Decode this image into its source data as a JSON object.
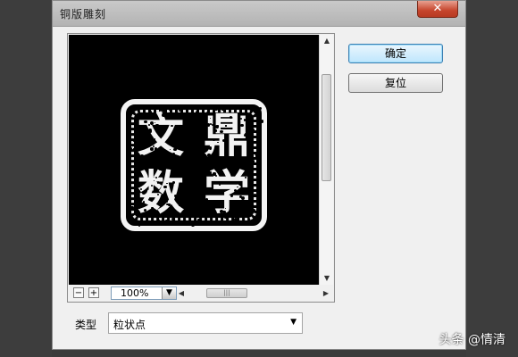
{
  "dialog": {
    "title": "铜版雕刻",
    "close_glyph": "✕"
  },
  "preview": {
    "stamp_characters": [
      "文",
      "鼎",
      "数",
      "学"
    ]
  },
  "zoom": {
    "minus": "−",
    "plus": "+",
    "value": "100%"
  },
  "buttons": {
    "ok": "确定",
    "reset": "复位"
  },
  "type": {
    "label": "类型",
    "value": "粒状点"
  },
  "watermark": "头条 @情清"
}
